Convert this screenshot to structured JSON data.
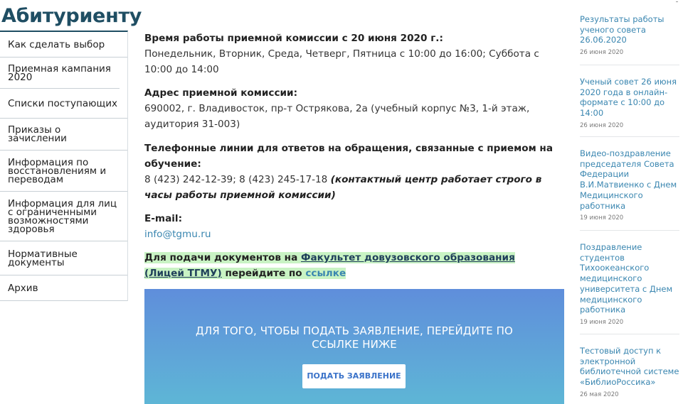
{
  "page_title": "Абитуриенту",
  "sidebar": {
    "items": [
      {
        "label": "Как сделать выбор"
      },
      {
        "label": "Приемная кампания 2020"
      },
      {
        "label": "Списки поступающих"
      },
      {
        "label": "Приказы о зачислении"
      },
      {
        "label": "Информация по восстановлениям и переводам"
      },
      {
        "label": "Информация для лиц с ограниченными возможностями здоровья"
      },
      {
        "label": "Нормативные документы"
      },
      {
        "label": "Архив"
      }
    ]
  },
  "main": {
    "hours": {
      "title": "Время работы приемной комиссии с 20 июня 2020 г.:",
      "text": "Понедельник, Вторник, Среда, Четверг, Пятница с 10:00 до 16:00; Суббота с 10:00 до 14:00"
    },
    "address": {
      "title": "Адрес приемной комиссии:",
      "text": "690002, г. Владивосток, пр-т Острякова, 2а (учебный корпус №3, 1-й этаж, аудитория 31-003)"
    },
    "phones": {
      "title": "Телефонные линии для ответов на обращения, связанные с приемом на обучение:",
      "text": "8 (423) 242-12-39; 8 (423) 245-17-18",
      "note": "(контактный центр работает строго в часы работы приемной комиссии)"
    },
    "email": {
      "title": "E-mail:",
      "value": "info@tgmu.ru"
    },
    "notice": {
      "prefix": "Для подачи документов на",
      "faculty_link": "Факультет довузовского образования (Лицей ТГМУ)",
      "middle": "перейдите по",
      "link": "ссылке"
    },
    "cta": {
      "text": "ДЛЯ ТОГО, ЧТОБЫ ПОДАТЬ ЗАЯВЛЕНИЕ, ПЕРЕЙДИТЕ ПО ССЫЛКЕ НИЖЕ",
      "button": "ПОДАТЬ ЗАЯВЛЕНИЕ"
    }
  },
  "news": [
    {
      "title": "Результаты работы ученого совета 26.06.2020",
      "date": "26 июня 2020"
    },
    {
      "title": "Ученый совет 26 июня 2020 года в онлайн-формате с 10:00 до 14:00",
      "date": "26 июня 2020"
    },
    {
      "title": "Видео-поздравление председателя Совета Федерации В.И.Матвиенко с Днем Медицинского работника",
      "date": "19 июня 2020"
    },
    {
      "title": "Поздравление студентов Тихоокеанского медицинского университета с Днем медицинского работника",
      "date": "19 июня 2020"
    },
    {
      "title": "Тестовый доступ к электронной библиотечной системе «БиблиоРоссика»",
      "date": "26 мая 2020"
    }
  ]
}
